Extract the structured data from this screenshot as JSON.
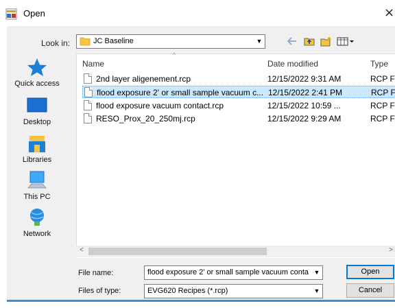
{
  "window": {
    "title": "Open",
    "close_glyph": "×"
  },
  "look_in": {
    "label": "Look in:",
    "value": "JC Baseline"
  },
  "toolbar": {
    "back_icon": "back-arrow-icon",
    "up_icon": "up-folder-icon",
    "new_folder_icon": "new-folder-icon",
    "view_icon": "view-menu-icon"
  },
  "places": [
    {
      "label": "Quick access",
      "icon": "star-icon"
    },
    {
      "label": "Desktop",
      "icon": "desktop-icon"
    },
    {
      "label": "Libraries",
      "icon": "libraries-icon"
    },
    {
      "label": "This PC",
      "icon": "computer-icon"
    },
    {
      "label": "Network",
      "icon": "network-icon"
    }
  ],
  "file_list": {
    "columns": [
      "Name",
      "Date modified",
      "Type"
    ],
    "files": [
      {
        "name": "2nd layer aligenement.rcp",
        "date": "12/15/2022 9:31 AM",
        "type": "RCP File",
        "selected": false
      },
      {
        "name": "flood exposure 2' or small sample vacuum c...",
        "date": "12/15/2022 2:41 PM",
        "type": "RCP File",
        "selected": true
      },
      {
        "name": "flood exposure vacuum contact.rcp",
        "date": "12/15/2022 10:59 ...",
        "type": "RCP File",
        "selected": false
      },
      {
        "name": "RESO_Prox_20_250mj.rcp",
        "date": "12/15/2022 9:29 AM",
        "type": "RCP File",
        "selected": false
      }
    ]
  },
  "scrollbar": {
    "left_arrow": "<",
    "right_arrow": ">"
  },
  "file_name": {
    "label": "File name:",
    "value": "flood exposure 2' or small sample vacuum conta"
  },
  "file_type": {
    "label": "Files of type:",
    "value": "EVG620 Recipes (*.rcp)"
  },
  "buttons": {
    "open": "Open",
    "cancel": "Cancel"
  },
  "colors": {
    "selection": "#cce8ff",
    "accent": "#0078d7",
    "bottom_bar": "#3c8dd6"
  }
}
